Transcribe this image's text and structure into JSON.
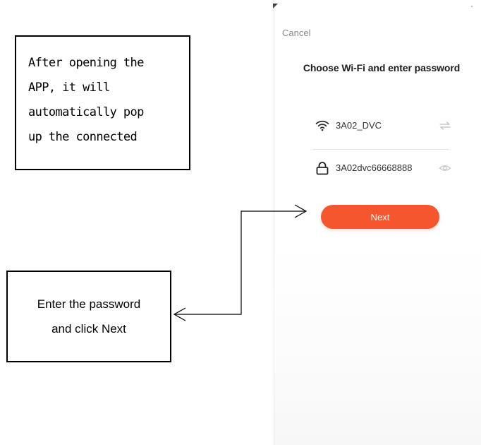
{
  "annotations": {
    "top": [
      "After opening the",
      "APP, it will",
      "automatically pop",
      "up the connected"
    ],
    "bottom": [
      "Enter the password",
      "and click Next"
    ]
  },
  "phone": {
    "cancel_label": "Cancel",
    "title": "Choose Wi-Fi and enter password",
    "wifi": {
      "icon": "wifi-icon",
      "ssid": "3A02_DVC",
      "switch_icon": "switch-network-icon"
    },
    "password": {
      "icon": "lock-icon",
      "value": "3A02dvc66668888",
      "toggle_icon": "eye-icon"
    },
    "next_label": "Next"
  },
  "colors": {
    "accent": "#f5562d",
    "muted_icon": "#bdbdbd"
  }
}
